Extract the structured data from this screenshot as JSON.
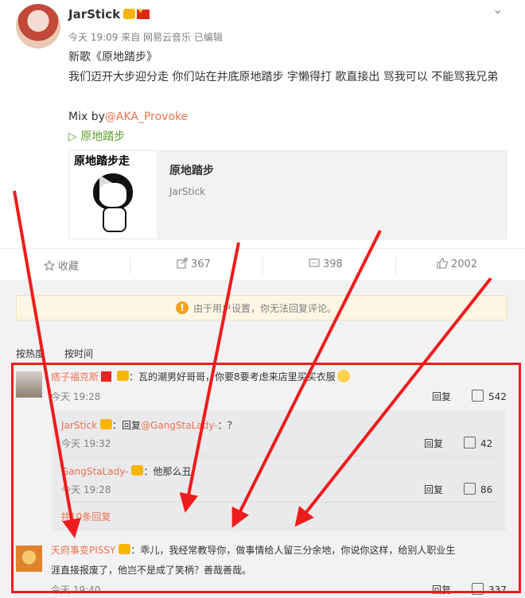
{
  "post": {
    "username": "JarStick",
    "meta": "今天 19:09 来自 网易云音乐   已编辑",
    "line1": "新歌《原地踏步》",
    "line2": "我们迈开大步迎分走 你们站在井底原地踏步 字懒得打 歌直接出 骂我可以 不能骂我兄弟",
    "mix_prefix": "Mix by",
    "mix_link": "@AKA_Provoke",
    "music_link": "▷ 原地踏步",
    "card": {
      "cover_title": "原地踏步走",
      "title": "原地踏步",
      "artist": "JarStick"
    }
  },
  "actions": {
    "favorite": "收藏",
    "repost": "367",
    "comment": "398",
    "like": "2002"
  },
  "notice": "由于用户设置，你无法回复评论。",
  "sort": {
    "hot": "按热度",
    "time": "按时间"
  },
  "comments": [
    {
      "name": "痞子福克斯",
      "text": "：瓦的潮男好哥哥，你要8要考虑来店里买买衣服",
      "time": "今天 19:28",
      "reply": "回复",
      "likes": "542"
    },
    {
      "name": "JarStick",
      "text": "：回复",
      "mention": "@GangStaLady-",
      "text2": "：？",
      "time": "今天 19:32",
      "reply": "回复",
      "likes": "42"
    },
    {
      "name": "GangStaLady-",
      "text": "：他那么丑",
      "time": "今天 19:28",
      "reply": "回复",
      "likes": "86"
    },
    {
      "name": "天府事变PISSY",
      "text": "：乖儿，我经常教导你，做事情给人留三分余地，你说你这样，给别人职业生",
      "text_line2": "涯直接报废了，他岂不是成了笑柄？善哉善哉。",
      "time": "今天 19:40",
      "reply": "回复",
      "likes": "337"
    }
  ],
  "more_replies": "共10条回复",
  "colors": {
    "link": "#eb7350",
    "green": "#5b9e2c",
    "highlight": "#ee1c1c"
  }
}
